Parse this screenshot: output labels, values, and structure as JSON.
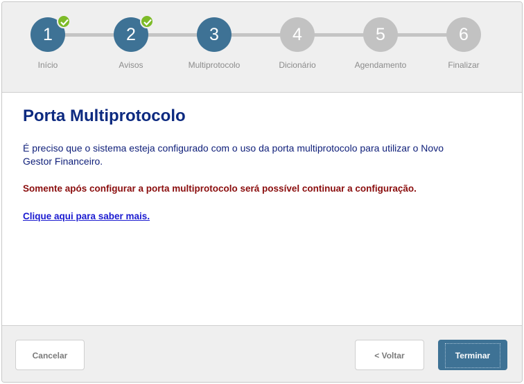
{
  "wizard": {
    "steps": [
      {
        "number": "1",
        "label": "Início",
        "status": "done"
      },
      {
        "number": "2",
        "label": "Avisos",
        "status": "done"
      },
      {
        "number": "3",
        "label": "Multiprotocolo",
        "status": "current"
      },
      {
        "number": "4",
        "label": "Dicionário",
        "status": "todo"
      },
      {
        "number": "5",
        "label": "Agendamento",
        "status": "todo"
      },
      {
        "number": "6",
        "label": "Finalizar",
        "status": "todo"
      }
    ],
    "colors": {
      "active": "#3e7295",
      "inactive": "#c2c2c2",
      "check": "#7dbb28"
    }
  },
  "content": {
    "title": "Porta Multiprotocolo",
    "description": "É preciso que o sistema esteja configurado com o uso da porta multiprotocolo para utilizar o Novo Gestor Financeiro.",
    "warning": "Somente após configurar a porta multiprotocolo será possível continuar a configuração.",
    "link": "Clique aqui para saber mais. ",
    "colors": {
      "title": "#0d2a80",
      "warning": "#8a0d0d",
      "link": "#1a1ad0"
    }
  },
  "footer": {
    "cancel_label": "Cancelar",
    "back_label": "< Voltar",
    "finish_label": "Terminar"
  }
}
